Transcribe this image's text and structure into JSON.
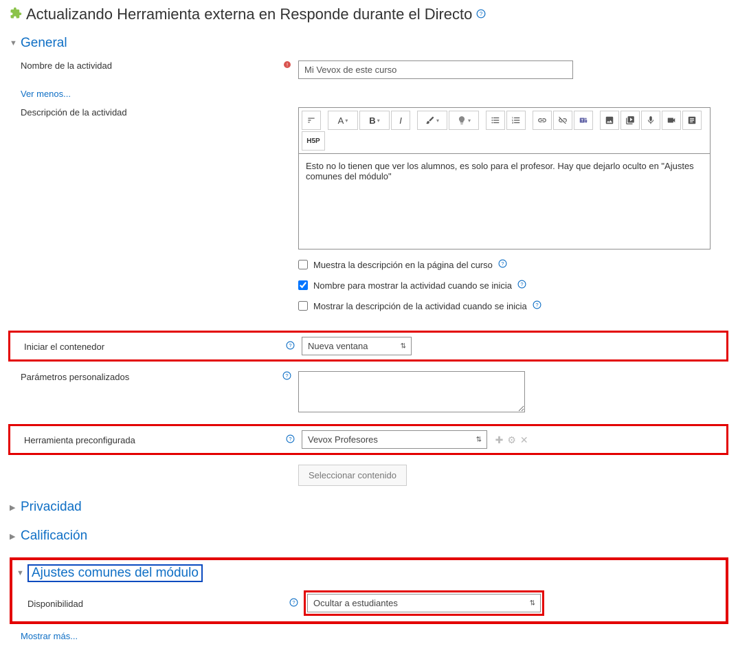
{
  "page": {
    "title": "Actualizando Herramienta externa en Responde durante el Directo"
  },
  "sections": {
    "general": {
      "title": "General"
    },
    "privacy": {
      "title": "Privacidad"
    },
    "grade": {
      "title": "Calificación"
    },
    "common": {
      "title": "Ajustes comunes del módulo"
    }
  },
  "labels": {
    "activity_name": "Nombre de la actividad",
    "show_less": "Ver menos...",
    "activity_desc": "Descripción de la actividad",
    "show_desc_course": "Muestra la descripción en la página del curso",
    "show_name_launch": "Nombre para mostrar la actividad cuando se inicia",
    "show_desc_launch": "Mostrar la descripción de la actividad cuando se inicia",
    "launch_container": "Iniciar el contenedor",
    "custom_params": "Parámetros personalizados",
    "preconf_tool": "Herramienta preconfigurada",
    "select_content": "Seleccionar contenido",
    "availability": "Disponibilidad",
    "show_more": "Mostrar más..."
  },
  "values": {
    "activity_name": "Mi Vevox de este curso",
    "description": "Esto no lo tienen que ver los alumnos, es solo para el profesor. Hay que dejarlo oculto en \"Ajustes comunes del módulo\"",
    "launch_container": "Nueva ventana",
    "custom_params": "",
    "preconf_tool": "Vevox Profesores",
    "availability": "Ocultar a estudiantes"
  },
  "checkboxes": {
    "show_desc_course": false,
    "show_name_launch": true,
    "show_desc_launch": false
  },
  "rte_label": "H5P"
}
